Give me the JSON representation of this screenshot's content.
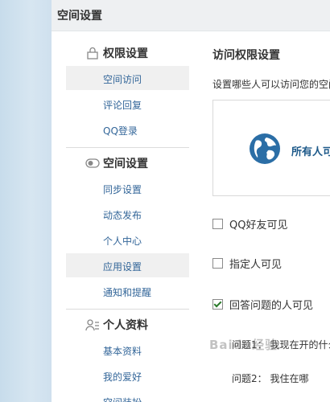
{
  "panel": {
    "title": "空间设置"
  },
  "sidebar": {
    "sections": [
      {
        "title": "权限设置",
        "icon": "lock-icon",
        "items": [
          {
            "label": "空间访问",
            "active": true
          },
          {
            "label": "评论回复"
          },
          {
            "label": "QQ登录"
          }
        ]
      },
      {
        "title": "空间设置",
        "icon": "toggle-icon",
        "items": [
          {
            "label": "同步设置"
          },
          {
            "label": "动态发布"
          },
          {
            "label": "个人中心"
          },
          {
            "label": "应用设置",
            "active": true
          },
          {
            "label": "通知和提醒"
          }
        ]
      },
      {
        "title": "个人资料",
        "icon": "profile-icon",
        "items": [
          {
            "label": "基本资料"
          },
          {
            "label": "我的爱好"
          },
          {
            "label": "空间装扮"
          }
        ]
      }
    ]
  },
  "content": {
    "title": "访问权限设置",
    "description": "设置哪些人可以访问您的空间",
    "preview_label": "所有人可见",
    "options": [
      {
        "label": "QQ好友可见",
        "checked": false
      },
      {
        "label": "指定人可见",
        "checked": false
      },
      {
        "label": "回答问题的人可见",
        "checked": true
      }
    ],
    "questions": [
      {
        "label": "问题1：",
        "text": "我现在开的什么车"
      },
      {
        "label": "问题2：",
        "text": "我住在哪"
      }
    ]
  },
  "watermark": "Baidu经验",
  "colors": {
    "link": "#336699",
    "globe": "#2b6ea6",
    "accent_text": "#1e5a8a"
  }
}
